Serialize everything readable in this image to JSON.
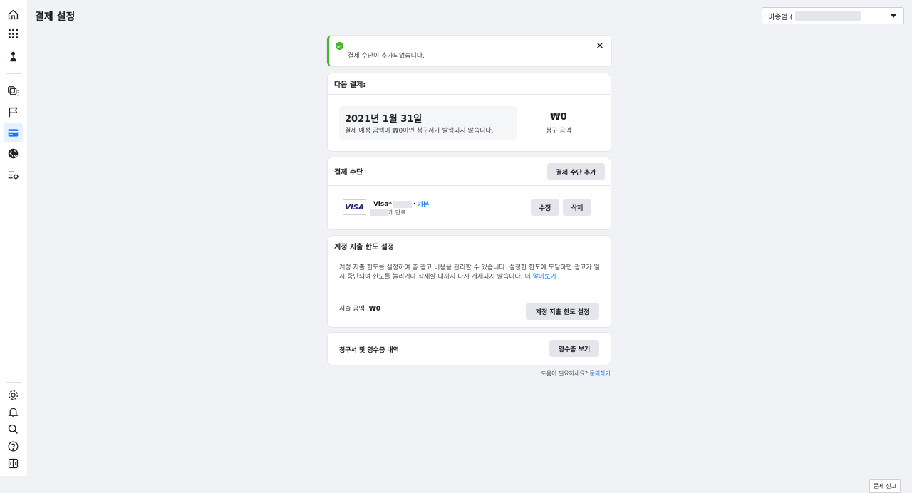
{
  "header": {
    "title": "결제 설정",
    "account_prefix": "이종범 ("
  },
  "toast": {
    "message": "결제 수단이 추가되었습니다.",
    "close": "✕"
  },
  "next_payment": {
    "header": "다음 결제:",
    "date": "2021년 1월 31일",
    "note": "결제 예정 금액이 ₩0이면 청구서가 발행되지 않습니다.",
    "amount": "₩0",
    "amount_label": "청구 금액"
  },
  "payment_methods": {
    "header": "결제 수단",
    "add_button": "결제 수단 추가",
    "card": {
      "brand": "VISA",
      "prefix": "Visa*",
      "sep": "·",
      "default_label": "기본",
      "expiry_suffix": "게 만료"
    },
    "edit_button": "수정",
    "delete_button": "삭제"
  },
  "spending_limit": {
    "header": "계정 지출 한도 설정",
    "description": "계정 지출 한도를 설정하여 총 광고 비용을 관리할 수 있습니다. 설정한 한도에 도달하면 광고가 일시 중단되며 한도를 늘리거나 삭제할 때까지 다시 게재되지 않습니다. ",
    "learn_more": "더 알아보기",
    "spent_label": "지출 금액: ",
    "spent_value": "₩0",
    "button": "계정 지출 한도 설정"
  },
  "invoices": {
    "title": "청구서 및 영수증 내역",
    "button": "영수증 보기"
  },
  "help": {
    "text": "도움이 필요하세요? ",
    "link": "문의하기"
  },
  "report_button": "문제 신고",
  "colors": {
    "accent": "#1877f2",
    "success": "#42b72a",
    "background": "#f0f2f5"
  }
}
